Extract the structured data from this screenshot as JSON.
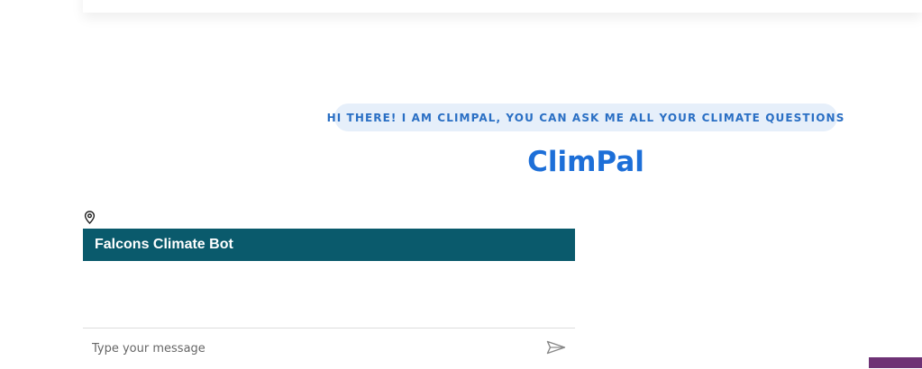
{
  "greeting": "HI THERE! I AM CLIMPAL, YOU CAN ASK ME ALL YOUR CLIMATE QUESTIONS",
  "app_title": "ClimPal",
  "chat": {
    "header_title": "Falcons Climate Bot",
    "input_placeholder": "Type your message",
    "input_value": ""
  },
  "icons": {
    "location": "location-pin-icon",
    "send": "send-icon"
  },
  "colors": {
    "accent": "#1d6fd8",
    "greeting_bg": "#e6effa",
    "header_bg": "#0a5a6c",
    "corner_tab": "#6e3275"
  }
}
